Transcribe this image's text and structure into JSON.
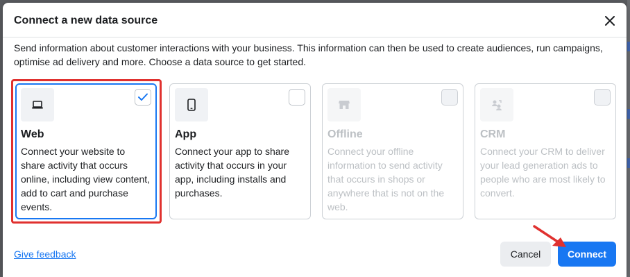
{
  "dialog": {
    "title": "Connect a new data source",
    "description": "Send information about customer interactions with your business. This information can then be used to create audiences, run campaigns, optimise ad delivery and more. Choose a data source to get started.",
    "close_icon": "close-icon"
  },
  "cards": [
    {
      "title": "Web",
      "description": "Connect your website to share activity that occurs online, including view content, add to cart and purchase events.",
      "icon": "laptop-icon",
      "checked": true,
      "disabled": false
    },
    {
      "title": "App",
      "description": "Connect your app to share activity that occurs in your app, including installs and purchases.",
      "icon": "mobile-icon",
      "checked": false,
      "disabled": false
    },
    {
      "title": "Offline",
      "description": "Connect your offline information to send activity that occurs in shops or anywhere that is not on the web.",
      "icon": "store-icon",
      "checked": false,
      "disabled": true
    },
    {
      "title": "CRM",
      "description": "Connect your CRM to deliver your lead generation ads to people who are most likely to convert.",
      "icon": "crm-people-icon",
      "checked": false,
      "disabled": true
    }
  ],
  "footer": {
    "feedback_link": "Give feedback",
    "cancel_label": "Cancel",
    "connect_label": "Connect"
  },
  "colors": {
    "accent": "#1877f2",
    "highlight": "#e0312f",
    "disabled_text": "#bcc0c4"
  }
}
